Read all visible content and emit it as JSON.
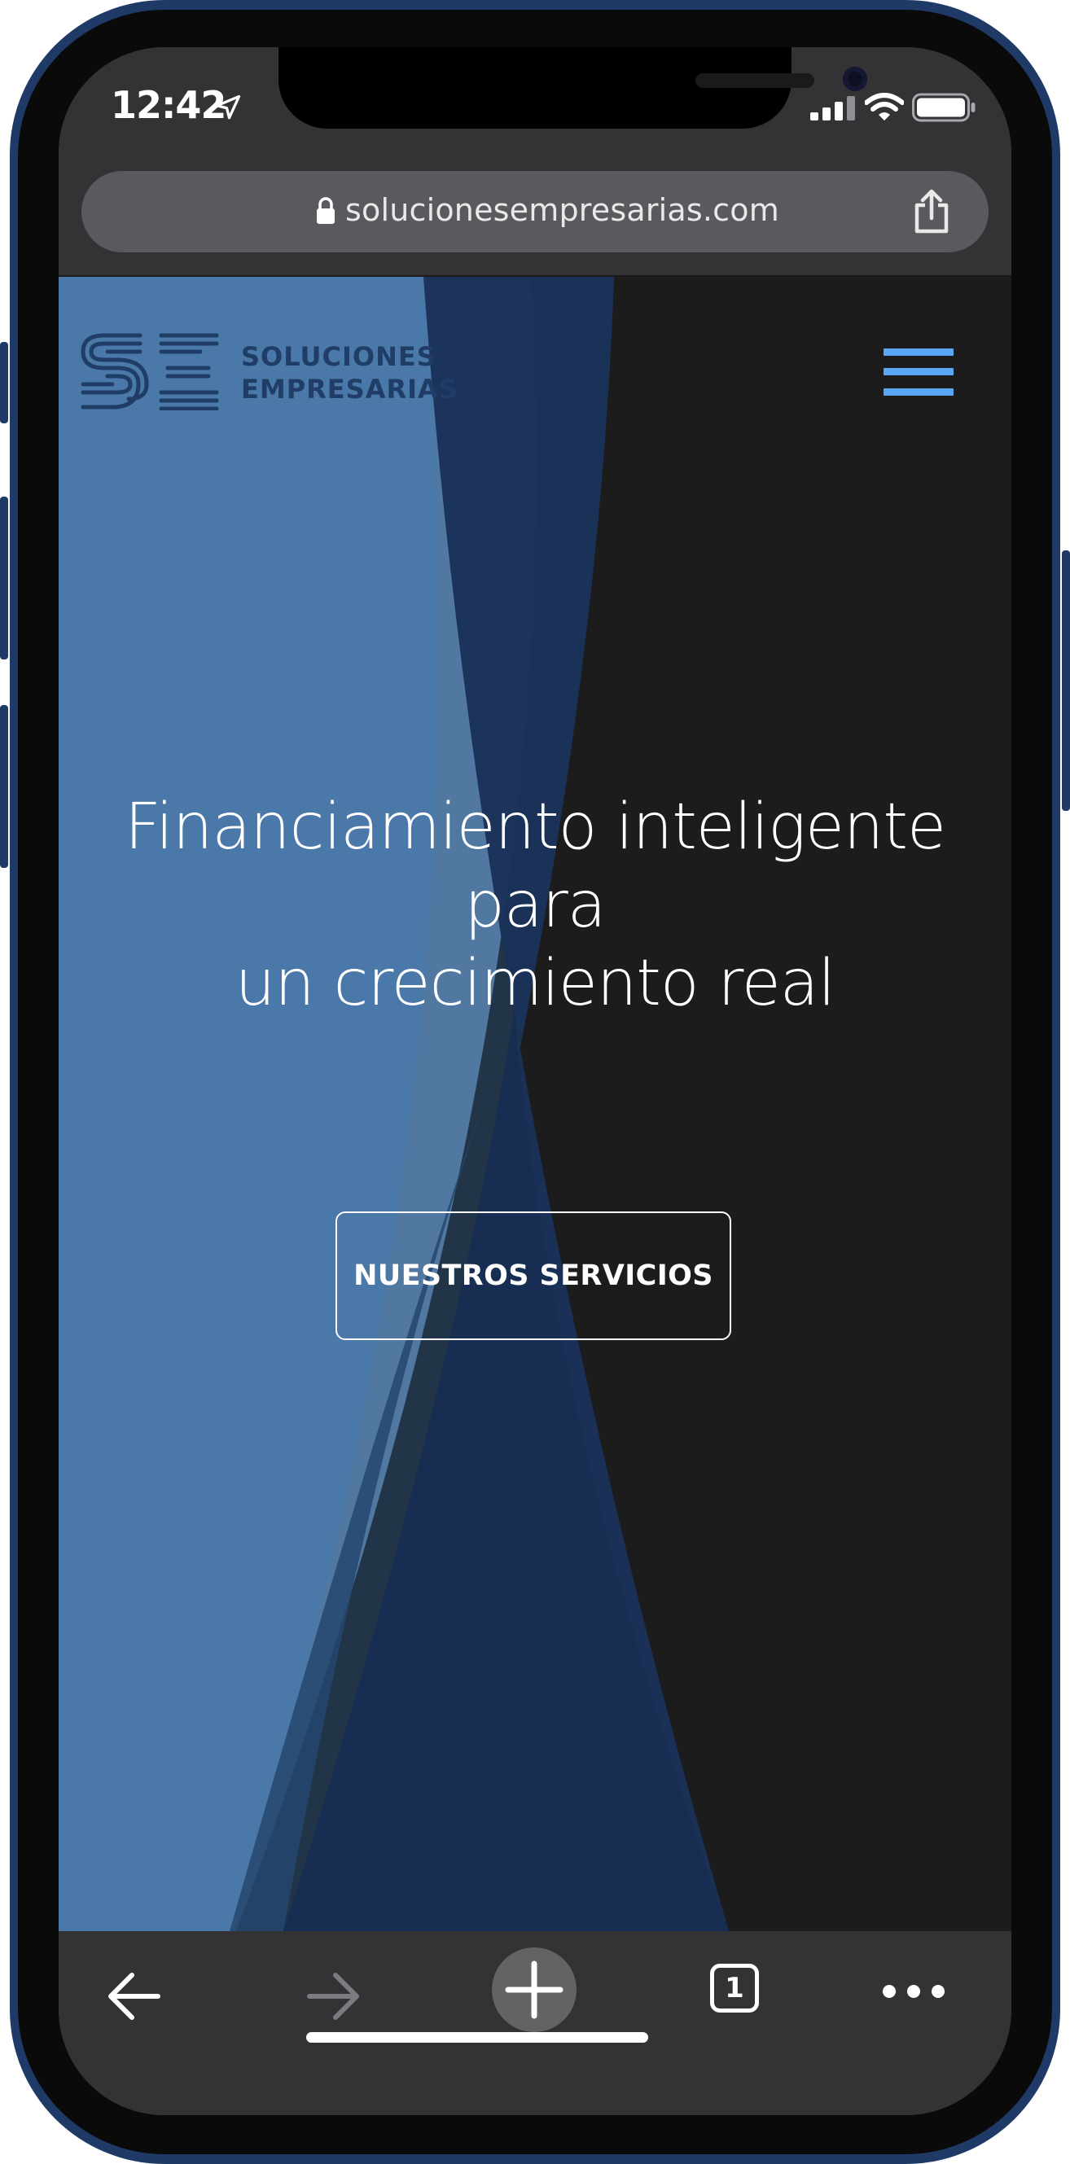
{
  "status_bar": {
    "time": "12:42"
  },
  "browser": {
    "url": "solucionesempresarias.com",
    "tab_count": "1"
  },
  "site": {
    "logo_text": "SOLUCIONES\nEMPRESARIAS",
    "headline": "Financiamiento inteligente para\nun crecimiento real",
    "cta_label": "NUESTROS SERVICIOS"
  },
  "colors": {
    "accent": "#5aa8f5",
    "hero_blue": "#4a78a8",
    "navy": "#1a3158",
    "dark_bg": "#1c1c1d"
  },
  "icons": {
    "location": "location-arrow-icon",
    "signal": "cellular-signal-icon",
    "wifi": "wifi-icon",
    "battery": "battery-icon",
    "lock": "lock-icon",
    "share": "share-icon",
    "menu": "hamburger-menu-icon",
    "back": "arrow-left-icon",
    "forward": "arrow-right-icon",
    "new_tab": "plus-icon",
    "tabs": "tab-switcher-icon",
    "more": "ellipsis-icon"
  }
}
